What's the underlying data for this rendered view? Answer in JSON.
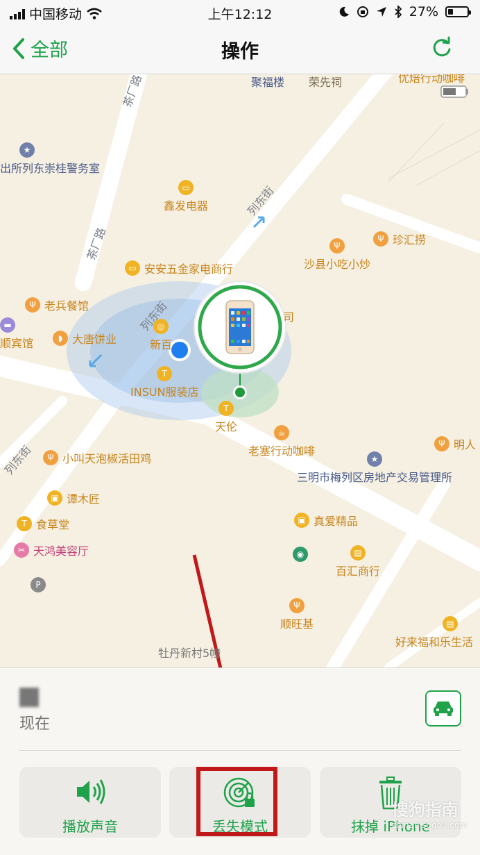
{
  "status_bar": {
    "carrier": "中国移动",
    "time": "上午12:12",
    "battery_percent": "27%",
    "battery_level": 0.27,
    "icons": [
      "signal-icon",
      "wifi-icon",
      "moon-icon",
      "rotation-lock-icon",
      "location-icon",
      "bluetooth-icon",
      "battery-icon"
    ]
  },
  "nav": {
    "back_label": "全部",
    "title": "操作",
    "refresh_icon": "refresh-icon"
  },
  "map": {
    "roads": {
      "chafang_top": "茶厂路",
      "chafang_mid": "茶厂路",
      "liedong_1": "列东街",
      "liedong_2": "列东街",
      "liedong_3": "列东街"
    },
    "pois": {
      "jufulou": "聚福楼",
      "rongxianci": "荣先祠",
      "youtai_coffee": "优焙行动咖啡",
      "police": "出所列东崇桂警务室",
      "xinfa": "鑫发电器",
      "zhenhuilao": "珍汇捞",
      "shaxian": "沙县小吃小炒",
      "anan": "安安五金家电商行",
      "laobing": "老兵餐馆",
      "binguan": "顺宾馆",
      "datang": "大唐饼业",
      "xinbai": "新百",
      "si": "司",
      "insun": "INSUN服装店",
      "tianlun": "天伦",
      "laosai": "老塞行动咖啡",
      "ming": "明人",
      "xiaojiao": "小叫天泡椒活田鸡",
      "realty": "三明市梅列区房地产交易管理所",
      "tanmujiang": "谭木匠",
      "shicaotang": "食草堂",
      "zhenai": "真爱精品",
      "tianhong": "天鸿美容厅",
      "baihui": "百汇商行",
      "shunwangji": "顺旺基",
      "haolaifu": "好来福和乐生活",
      "mudan": "牡丹新村5幢"
    }
  },
  "bottom": {
    "device_name": "",
    "time_label": "现在",
    "car_icon": "car-icon",
    "actions": [
      {
        "label": "播放声音",
        "icon": "speaker-icon"
      },
      {
        "label": "丢失模式",
        "icon": "lost-mode-icon"
      },
      {
        "label": "抹掉 iPhone",
        "icon": "trash-icon"
      }
    ]
  },
  "watermark": {
    "text": "搜狗指南",
    "sub": "zhinan.sogou.com"
  },
  "colors": {
    "accent": "#1fa24a",
    "highlight": "#c0191a",
    "map_bg": "#f6f0e2",
    "poi_orange": "#f1a040",
    "user_dot": "#1e7ef0"
  }
}
